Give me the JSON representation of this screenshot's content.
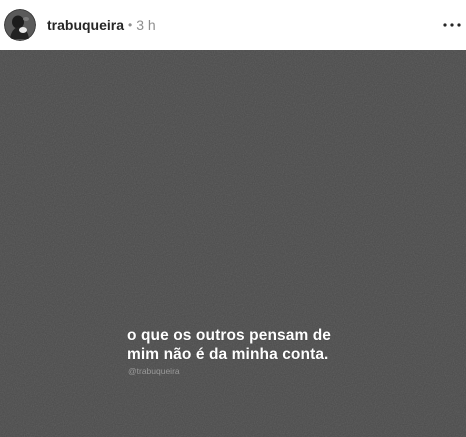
{
  "post": {
    "username": "trabuqueira",
    "separator": "•",
    "time": "3 h",
    "avatar_icon": "profile-avatar-icon",
    "more_icon": "more-options-icon"
  },
  "image": {
    "background_color": "#4b4b4b",
    "text_lines": [
      "o que os outros pensam de",
      "mim não é da minha conta."
    ],
    "watermark": "@trabuqueira"
  }
}
